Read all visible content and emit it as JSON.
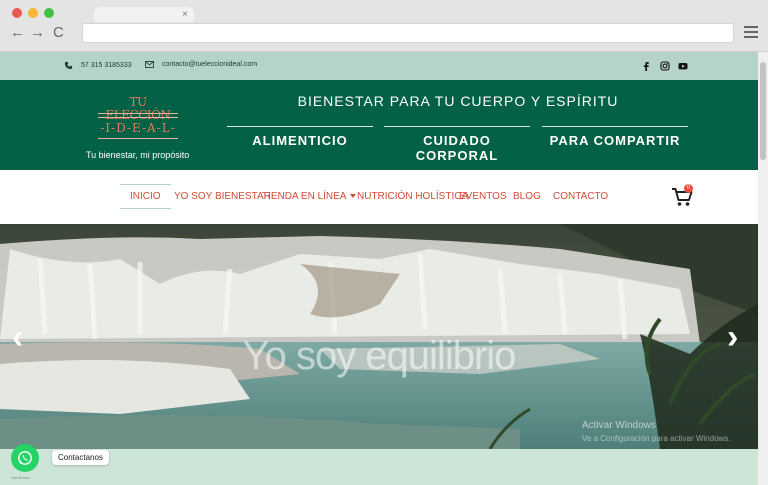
{
  "browser": {
    "tab_close": "×",
    "back": "←",
    "forward": "→",
    "reload": "C"
  },
  "topbar": {
    "phone": "57 315 3185333",
    "email": "contacto@tueleccionideal.com",
    "social_icons": [
      "facebook-icon",
      "instagram-icon",
      "youtube-icon"
    ]
  },
  "header": {
    "logo_line1": "TU ELECCIÓN",
    "logo_line2": "-I-D-E-A-L-",
    "tagline": "Tu bienestar, mi propósito",
    "title": "BIENESTAR PARA TU CUERPO Y ESPÍRITU",
    "categories": [
      "ALIMENTICIO",
      "CUIDADO CORPORAL",
      "PARA COMPARTIR"
    ]
  },
  "nav": {
    "items": [
      "INICIO",
      "YO SOY BIENESTAR",
      "TIENDA EN LÍNEA",
      "NUTRICIÓN HOLÍSTICA",
      "EVENTOS",
      "BLOG",
      "CONTACTO"
    ],
    "active": "INICIO",
    "cart_count": "0"
  },
  "hero": {
    "caption": "Yo soy equilibrio",
    "prev": "‹",
    "next": "›"
  },
  "watermark": {
    "line1": "Activar Windows",
    "line2": "Ve a Configuración para activar Windows."
  },
  "whatsapp": {
    "label": "Contactanos",
    "small": "Get Button"
  },
  "colors": {
    "topbar": "#b5d3c7",
    "header": "#036146",
    "accent": "#cf4c34",
    "logo": "#e07a57"
  }
}
